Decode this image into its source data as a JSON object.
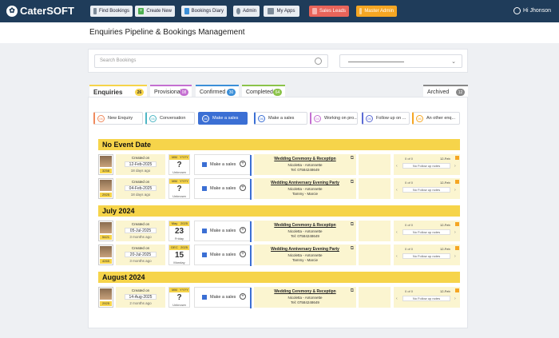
{
  "app": {
    "logo": "CaterSOFT"
  },
  "toolbar": {
    "find_bookings": "Find Bookings",
    "create_new": "Create New",
    "bookings_diary": "Bookings Diary",
    "admin": "Admin",
    "my_apps": "My Apps",
    "sales_leads": "Sales Leads",
    "master_admin": "Master Admin"
  },
  "user": {
    "greeting": "Hi Jhonson"
  },
  "page": {
    "title": "Enquiries Pipeline & Bookings Management"
  },
  "search": {
    "placeholder": "Search Bookings"
  },
  "tabs": [
    {
      "label": "Enquiries",
      "count": "26",
      "color": "#f6d44a"
    },
    {
      "label": "Provisional",
      "count": "08",
      "color": "#c46fd1"
    },
    {
      "label": "Confirmed",
      "count": "30",
      "color": "#3b8fd8"
    },
    {
      "label": "Completed",
      "count": "64",
      "color": "#8bc34a"
    },
    {
      "label": "Archived",
      "count": "12",
      "color": "#888888"
    }
  ],
  "stages": [
    {
      "num": "06",
      "label": "New Enquiry",
      "color": "#f08a5d"
    },
    {
      "num": "06",
      "label": "Conversation",
      "color": "#4db6c4"
    },
    {
      "num": "06",
      "label": "Make a sales",
      "color": "#3b6fd4"
    },
    {
      "num": "06",
      "label": "Make a sales",
      "color": "#3b6fd4"
    },
    {
      "num": "03",
      "label": "Working on pro...",
      "color": "#c46fd1"
    },
    {
      "num": "05",
      "label": "Follow up on ...",
      "color": "#5b6bd4"
    },
    {
      "num": "06",
      "label": "An other enq...",
      "color": "#f5a623"
    }
  ],
  "groups": [
    {
      "title": "No Event Date"
    },
    {
      "title": "July 2024"
    },
    {
      "title": "August 2024"
    }
  ],
  "rows": [
    {
      "id": "3258",
      "created_label": "Created on",
      "created": "12-Feb-2025",
      "ago": "18 days ago",
      "mm": "MM",
      "yy": "YYYY",
      "day": "?",
      "weekday": "Unknown",
      "stage": "Make a sales",
      "event": "Wedding Ceremony & Receptipn",
      "line2": "Nicoletta - Antonnette",
      "line3": "Tel: 07584248649",
      "of": "0 of 0",
      "fdate": "12-Feb",
      "note": "No Follow up notes"
    },
    {
      "id": "2925",
      "created_label": "Created on",
      "created": "04-Feb-2025",
      "ago": "18 days ago",
      "mm": "MM",
      "yy": "YYYY",
      "day": "?",
      "weekday": "Unknown",
      "stage": "Make a sales",
      "event": "Wedding Anniversary Evening Party",
      "line2": "Nicoletta - Antonnette",
      "line3": "Tammy - Marcie",
      "of": "0 of 0",
      "fdate": "12-Feb",
      "note": "No Follow up notes"
    },
    {
      "id": "5421",
      "created_label": "Created on",
      "created": "05-Jul-2025",
      "ago": "3 months ago",
      "mm": "May",
      "yy": "2025",
      "day": "23",
      "weekday": "Friday",
      "stage": "Make a sales",
      "event": "Wedding Ceremony & Receptipn",
      "line2": "Nicoletta - Antonnette",
      "line3": "Tel: 07584248649",
      "of": "0 of 0",
      "fdate": "12-Feb",
      "note": "No Follow up notes"
    },
    {
      "id": "4265",
      "created_label": "Created on",
      "created": "20-Jul-2025",
      "ago": "3 months ago",
      "mm": "DEC",
      "yy": "2025",
      "day": "15",
      "weekday": "Monday",
      "stage": "Make a sales",
      "event": "Wedding Anniversary Evening Party",
      "line2": "Nicoletta - Antonnette",
      "line3": "Tammy - Marcie",
      "of": "0 of 0",
      "fdate": "12-Feb",
      "note": "No Follow up notes"
    },
    {
      "id": "2925",
      "created_label": "Created on",
      "created": "14-Aug-2025",
      "ago": "2 months ago",
      "mm": "MM",
      "yy": "YYYY",
      "day": "?",
      "weekday": "Unknown",
      "stage": "Make a sales",
      "event": "Wedding Ceremony & Receptipn",
      "line2": "Nicoletta - Antonnette",
      "line3": "Tel: 07584248649",
      "of": "0 of 0",
      "fdate": "12-Feb",
      "note": "No Follow up notes"
    }
  ]
}
